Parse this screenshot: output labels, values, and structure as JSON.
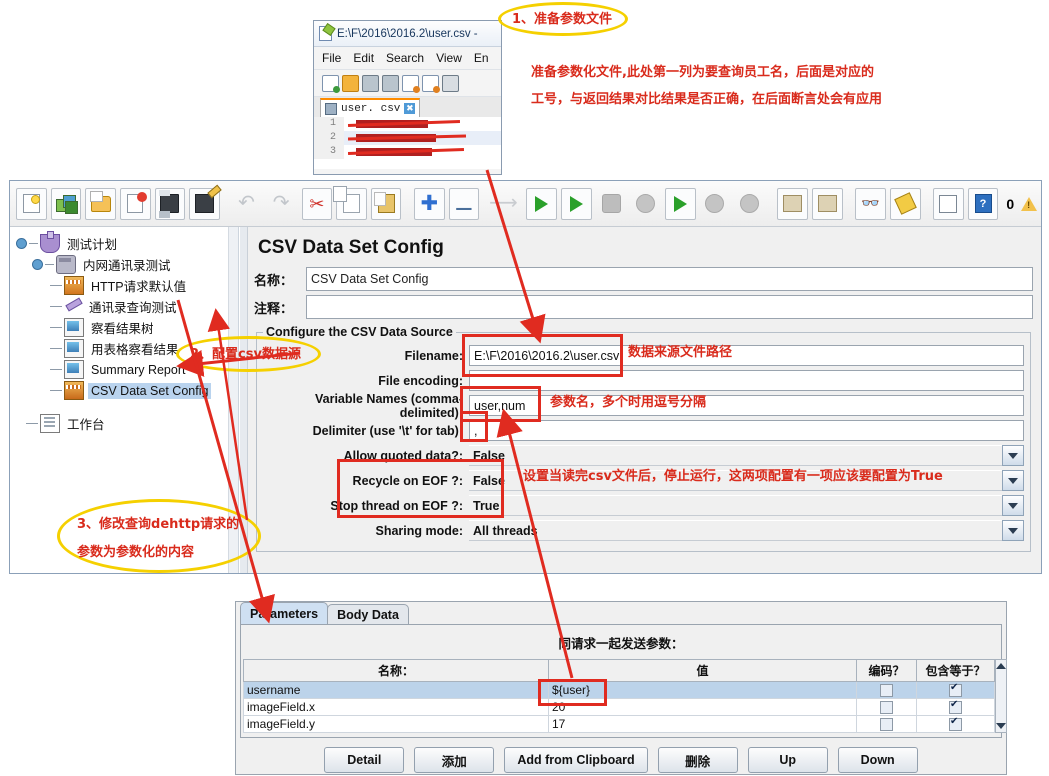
{
  "notepad": {
    "title": "E:\\F\\2016\\2016.2\\user.csv -",
    "menu": [
      "File",
      "Edit",
      "Search",
      "View",
      "En"
    ],
    "tab_label": "user. csv",
    "tab_close": "✖",
    "lines": [
      "1",
      "2",
      "3"
    ]
  },
  "annotations": {
    "step1_circle": "1、准备参数文件",
    "step1_text_line1": "准备参数化文件,此处第一列为要查询员工名，后面是对应的",
    "step1_text_line2": "工号，与返回结果对比结果是否正确，在后面断言处会有应用",
    "step2_circle": "2、配置csv数据源",
    "step3_circle_line1": "3、修改查询dehttp请求的",
    "step3_circle_line2": "参数为参数化的内容",
    "filename_note": "数据来源文件路径",
    "varnames_note": "参数名，多个时用逗号分隔",
    "eof_note": "设置当读完csv文件后，停止运行，这两项配置有一项应该要配置为True"
  },
  "toolbar": {
    "buttons": [
      {
        "name": "new",
        "icon": "new-document-icon"
      },
      {
        "name": "templates",
        "icon": "templates-icon"
      },
      {
        "name": "open",
        "icon": "open-folder-icon"
      },
      {
        "name": "close",
        "icon": "close-document-icon"
      },
      {
        "name": "save",
        "icon": "save-icon"
      },
      {
        "name": "save-as",
        "icon": "save-as-icon"
      },
      {
        "name": "undo",
        "icon": "undo-icon"
      },
      {
        "name": "redo",
        "icon": "redo-icon"
      },
      {
        "name": "cut",
        "icon": "scissors-icon"
      },
      {
        "name": "copy",
        "icon": "copy-icon"
      },
      {
        "name": "paste",
        "icon": "paste-icon"
      },
      {
        "name": "expand",
        "icon": "plus-icon"
      },
      {
        "name": "collapse",
        "icon": "minus-icon"
      },
      {
        "name": "toggle",
        "icon": "toggle-icon"
      },
      {
        "name": "start",
        "icon": "play-icon"
      },
      {
        "name": "start-no-pauses",
        "icon": "play-no-pause-icon"
      },
      {
        "name": "stop",
        "icon": "stop-icon"
      },
      {
        "name": "shutdown",
        "icon": "shutdown-icon"
      },
      {
        "name": "start-remote-all",
        "icon": "remote-start-icon"
      },
      {
        "name": "stop-remote-all",
        "icon": "remote-stop-icon"
      },
      {
        "name": "shutdown-remote-all",
        "icon": "remote-shutdown-icon"
      },
      {
        "name": "clear",
        "icon": "clear-icon"
      },
      {
        "name": "clear-all",
        "icon": "clear-all-icon"
      },
      {
        "name": "search",
        "icon": "binoculars-icon"
      },
      {
        "name": "reset-search",
        "icon": "reset-search-icon"
      },
      {
        "name": "function-helper",
        "icon": "function-helper-icon"
      },
      {
        "name": "help",
        "icon": "help-icon"
      }
    ],
    "error_count": "0",
    "warning_icon": "warning-triangle-icon"
  },
  "tree": {
    "items": [
      {
        "label": "测试计划",
        "icon": "test-plan-icon",
        "depth": 0,
        "selected": false
      },
      {
        "label": "内网通讯录测试",
        "icon": "thread-group-icon",
        "depth": 1,
        "selected": false
      },
      {
        "label": "HTTP请求默认值",
        "icon": "http-defaults-icon",
        "depth": 2,
        "selected": false
      },
      {
        "label": "通讯录查询测试",
        "icon": "sampler-icon",
        "depth": 2,
        "selected": false
      },
      {
        "label": "察看结果树",
        "icon": "listener-icon",
        "depth": 2,
        "selected": false
      },
      {
        "label": "用表格察看结果",
        "icon": "listener-icon",
        "depth": 2,
        "selected": false
      },
      {
        "label": "Summary Report",
        "icon": "listener-icon",
        "depth": 2,
        "selected": false
      },
      {
        "label": "CSV Data Set Config",
        "icon": "csv-config-icon",
        "depth": 2,
        "selected": true
      },
      {
        "label": "工作台",
        "icon": "workbench-icon",
        "depth": 0,
        "selected": false
      }
    ]
  },
  "config": {
    "title": "CSV Data Set Config",
    "name_label": "名称：",
    "name_value": "CSV Data Set Config",
    "comment_label": "注释：",
    "comment_value": "",
    "group_legend": "Configure the CSV Data Source",
    "fields": [
      {
        "label": "Filename:",
        "value": "E:\\F\\2016\\2016.2\\user.csv",
        "type": "text"
      },
      {
        "label": "File encoding:",
        "value": "",
        "type": "combo"
      },
      {
        "label": "Variable Names (comma-delimited):",
        "value": "user,num",
        "type": "text"
      },
      {
        "label": "Delimiter (use '\\t' for tab):",
        "value": ",",
        "type": "text"
      },
      {
        "label": "Allow quoted data?:",
        "value": "False",
        "type": "combo"
      },
      {
        "label": "Recycle on EOF ?:",
        "value": "False",
        "type": "combo"
      },
      {
        "label": "Stop thread on EOF ?:",
        "value": "True",
        "type": "combo"
      },
      {
        "label": "Sharing mode:",
        "value": "All threads",
        "type": "combo"
      }
    ]
  },
  "params_panel": {
    "tabs": [
      {
        "label": "Parameters",
        "active": true
      },
      {
        "label": "Body Data",
        "active": false
      }
    ],
    "caption": "同请求一起发送参数：",
    "columns": [
      "名称：",
      "值",
      "编码？",
      "包含等于？"
    ],
    "rows": [
      {
        "name": "username",
        "value": "${user}",
        "encode": false,
        "include_equals": true,
        "selected": true
      },
      {
        "name": "imageField.x",
        "value": "20",
        "encode": false,
        "include_equals": true,
        "selected": false
      },
      {
        "name": "imageField.y",
        "value": "17",
        "encode": false,
        "include_equals": true,
        "selected": false
      }
    ],
    "buttons": [
      "Detail",
      "添加",
      "Add from Clipboard",
      "删除",
      "Up",
      "Down"
    ]
  },
  "colors": {
    "annotation_red": "#d92b1c",
    "highlight_yellow": "#f5d000",
    "selection_blue": "#bcd3ea",
    "panel_gray": "#f0f0f0"
  }
}
